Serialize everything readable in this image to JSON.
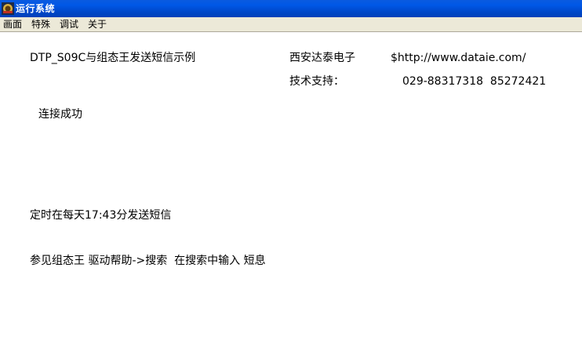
{
  "window": {
    "title": "运行系统"
  },
  "menu": {
    "items": [
      {
        "label": "画面"
      },
      {
        "label": "特殊"
      },
      {
        "label": "调试"
      },
      {
        "label": "关于"
      }
    ]
  },
  "content": {
    "heading": "DTP_S09C与组态王发送短信示例",
    "company": "西安达泰电子",
    "website": "$http://www.dataie.com/",
    "support_label": "技术支持：",
    "phone": "029-88317318  85272421",
    "status": "连接成功",
    "schedule": "定时在每天17:43分发送短信",
    "help": "参见组态王 驱动帮助->搜索  在搜索中输入 短息"
  },
  "colors": {
    "titlebar": "#0058e6",
    "menubar": "#ece9d8",
    "canvas": "#ffffff",
    "text": "#000000"
  }
}
